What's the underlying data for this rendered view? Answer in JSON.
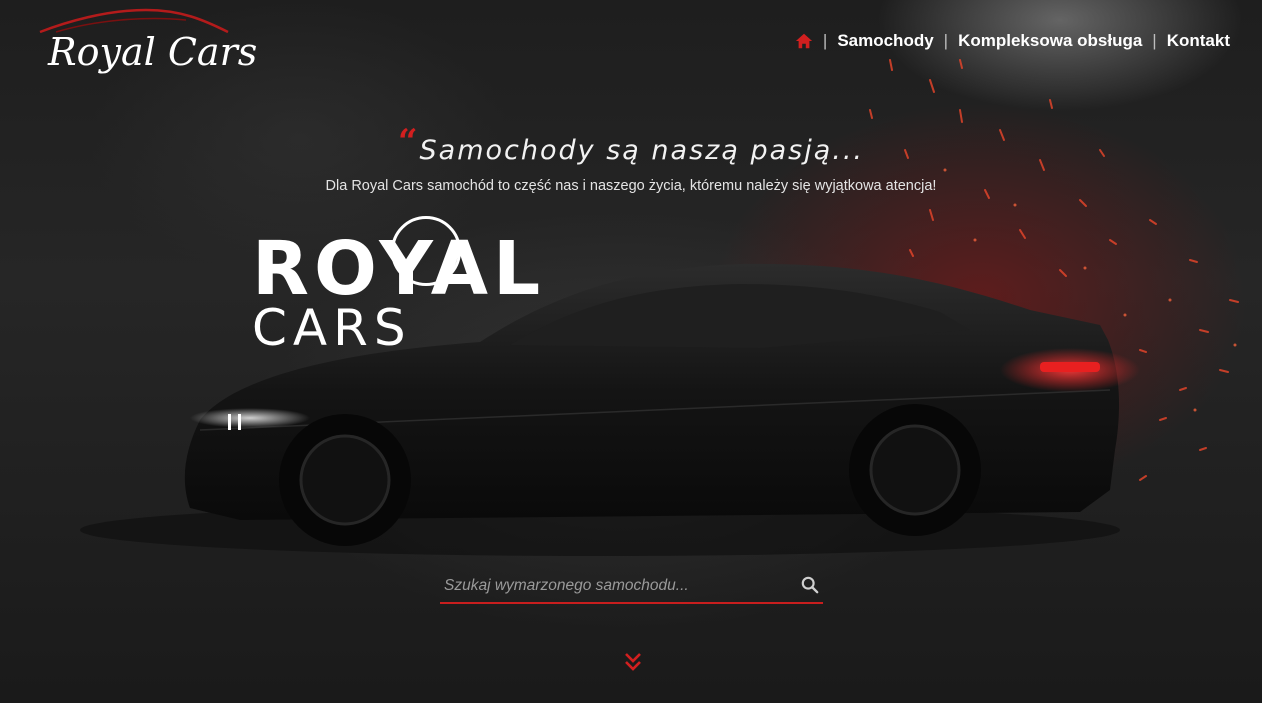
{
  "logo": {
    "text": "Royal Cars"
  },
  "nav": {
    "home_icon": "home-icon",
    "separator": "|",
    "items": [
      {
        "label": "Samochody"
      },
      {
        "label": "Kompleksowa obsługa"
      },
      {
        "label": "Kontakt"
      }
    ]
  },
  "hero": {
    "quote_mark": "“",
    "headline": "Samochody są naszą pasją...",
    "subtitle": "Dla Royal Cars samochód to część nas i naszego życia, któremu należy się wyjątkowa atencja!",
    "brand_line1": "ROYAL",
    "brand_line2": "CARS"
  },
  "search": {
    "placeholder": "Szukaj wymarzonego samochodu...",
    "value": "",
    "icon": "search-icon"
  },
  "scroll_down": {
    "icon": "double-chevron-down-icon"
  },
  "colors": {
    "accent": "#d21f1f",
    "text": "#ffffff",
    "background": "#1e1e1e"
  }
}
